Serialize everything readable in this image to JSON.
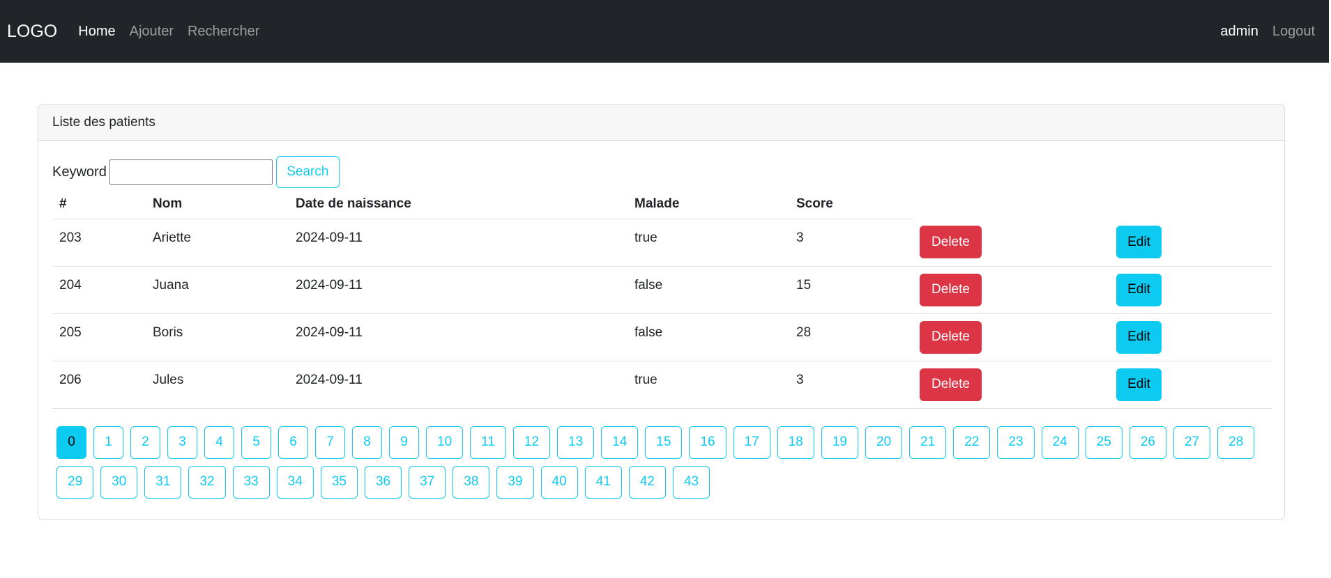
{
  "navbar": {
    "brand": "LOGO",
    "links": [
      {
        "label": "Home",
        "active": true
      },
      {
        "label": "Ajouter",
        "active": false
      },
      {
        "label": "Rechercher",
        "active": false
      }
    ],
    "user": "admin",
    "logout": "Logout"
  },
  "card": {
    "title": "Liste des patients"
  },
  "search": {
    "label": "Keyword",
    "value": "",
    "button": "Search"
  },
  "table": {
    "headers": [
      "#",
      "Nom",
      "Date de naissance",
      "Malade",
      "Score"
    ],
    "rows": [
      {
        "id": "203",
        "nom": "Ariette",
        "date": "2024-09-11",
        "malade": "true",
        "score": "3"
      },
      {
        "id": "204",
        "nom": "Juana",
        "date": "2024-09-11",
        "malade": "false",
        "score": "15"
      },
      {
        "id": "205",
        "nom": "Boris",
        "date": "2024-09-11",
        "malade": "false",
        "score": "28"
      },
      {
        "id": "206",
        "nom": "Jules",
        "date": "2024-09-11",
        "malade": "true",
        "score": "3"
      }
    ],
    "delete_label": "Delete",
    "edit_label": "Edit"
  },
  "pagination": {
    "current": "0",
    "pages": [
      "0",
      "1",
      "2",
      "3",
      "4",
      "5",
      "6",
      "7",
      "8",
      "9",
      "10",
      "11",
      "12",
      "13",
      "14",
      "15",
      "16",
      "17",
      "18",
      "19",
      "20",
      "21",
      "22",
      "23",
      "24",
      "25",
      "26",
      "27",
      "28",
      "29",
      "30",
      "31",
      "32",
      "33",
      "34",
      "35",
      "36",
      "37",
      "38",
      "39",
      "40",
      "41",
      "42",
      "43"
    ]
  },
  "colors": {
    "navbar_bg": "#212529",
    "info": "#0dcaf0",
    "danger": "#dc3545"
  }
}
